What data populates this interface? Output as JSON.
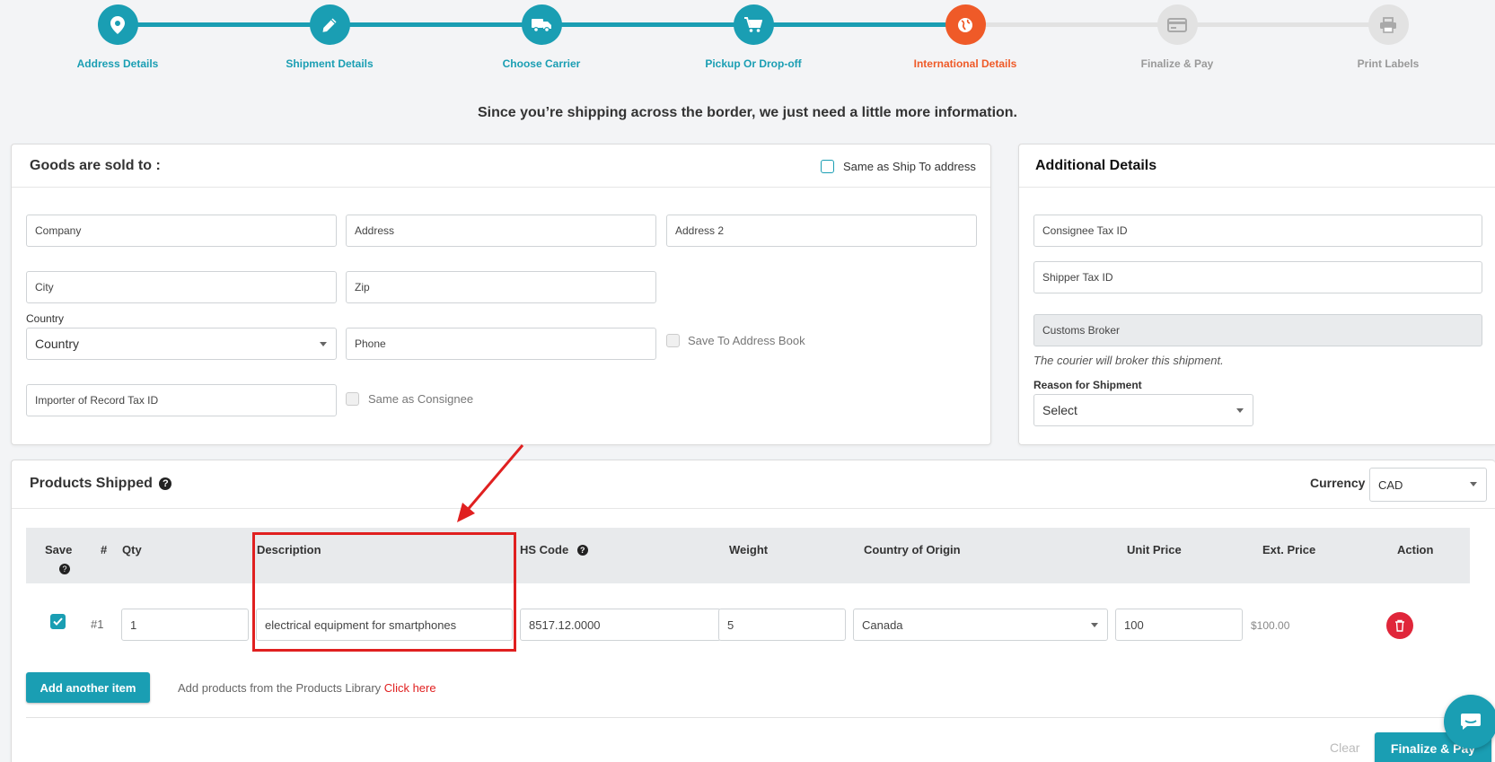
{
  "stepper": {
    "steps": [
      {
        "label": "Address Details",
        "icon": "map-pin-icon",
        "state": "done"
      },
      {
        "label": "Shipment Details",
        "icon": "pencil-icon",
        "state": "done"
      },
      {
        "label": "Choose Carrier",
        "icon": "truck-icon",
        "state": "done"
      },
      {
        "label": "Pickup Or Drop-off",
        "icon": "cart-icon",
        "state": "done"
      },
      {
        "label": "International Details",
        "icon": "globe-icon",
        "state": "active"
      },
      {
        "label": "Finalize & Pay",
        "icon": "credit-card-icon",
        "state": "pending"
      },
      {
        "label": "Print Labels",
        "icon": "printer-icon",
        "state": "pending"
      }
    ]
  },
  "headline": "Since you’re shipping across the border, we just need a little more information.",
  "goods": {
    "title": "Goods are sold to :",
    "same_as_ship": "Same as Ship To address",
    "company": "Company",
    "address": "Address",
    "address2": "Address 2",
    "city": "City",
    "zip": "Zip",
    "country_label": "Country",
    "country_value": "Country",
    "phone": "Phone",
    "save_address_book": "Save To Address Book",
    "importer_tax": "Importer of Record Tax ID",
    "same_as_consignee": "Same as Consignee"
  },
  "additional": {
    "title": "Additional Details",
    "consignee_tax": "Consignee Tax ID",
    "shipper_tax": "Shipper Tax ID",
    "customs_broker": "Customs Broker",
    "broker_note": "The courier will broker this shipment.",
    "reason_label": "Reason for Shipment",
    "reason_value": "Select"
  },
  "products": {
    "title": "Products Shipped",
    "currency_label": "Currency",
    "currency_value": "CAD",
    "columns": {
      "save": "Save",
      "num": "#",
      "qty": "Qty",
      "description": "Description",
      "hs_code": "HS Code",
      "weight": "Weight",
      "origin": "Country of Origin",
      "unit_price": "Unit Price",
      "ext_price": "Ext. Price",
      "action": "Action"
    },
    "row": {
      "num": "#1",
      "qty": "1",
      "description": "electrical equipment for smartphones",
      "hs_code": "8517.12.0000",
      "weight": "5",
      "origin": "Canada",
      "unit_price": "100",
      "ext_price": "$100.00"
    },
    "add_item": "Add another item",
    "library_text": "Add products from the Products Library",
    "library_link": "Click here"
  },
  "footer": {
    "clear": "Clear",
    "finalize": "Finalize & Pay"
  },
  "colors": {
    "teal": "#1a9eb3",
    "orange": "#ef5a28",
    "pending": "#dcdcdc",
    "annotation_red": "#e02020",
    "delete_red": "#e0263a"
  }
}
